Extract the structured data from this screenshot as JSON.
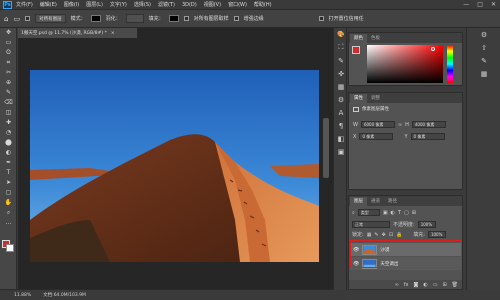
{
  "app": {
    "logo": "Ps"
  },
  "menu": [
    "文件(F)",
    "编辑(E)",
    "图像(I)",
    "图层(L)",
    "文字(Y)",
    "选择(S)",
    "滤镜(T)",
    "3D(D)",
    "视图(V)",
    "窗口(W)",
    "帮助(H)"
  ],
  "window_controls": [
    "—",
    "□",
    "✕"
  ],
  "options": {
    "mode_label": "对所有图层",
    "size_label": "模式：",
    "radius_label": "羽化：",
    "fill_label": "填充：",
    "sample_label": "对所有图层取样",
    "auto_label": "增强边缘",
    "check_label": "打开置位信用任"
  },
  "document": {
    "tab_label": "1撤天空.psd @ 11.7% (沙漠, RGB/8#) *",
    "status_zoom": "11.88%",
    "status_doc": "文档:64.0M/103.9M"
  },
  "tools": [
    "✥",
    "▭",
    "ʘ",
    "⌗",
    "✂",
    "⊕",
    "✎",
    "⌫",
    "◫",
    "✚",
    "◔",
    "⬤",
    "◐",
    "✒",
    "T",
    "➤",
    "▢",
    "✋",
    "⌕",
    "…"
  ],
  "strip_icons": [
    "🎨",
    "⛶",
    "✎",
    "✜",
    "▦",
    "⚙",
    "A",
    "¶",
    "◧",
    "▣"
  ],
  "color_panel": {
    "tabs": [
      "颜色",
      "色板"
    ],
    "fg": "#d62a2a",
    "bg": "#ffffff"
  },
  "properties": {
    "tabs": [
      "属性",
      "调整"
    ],
    "title": "像素图层属性",
    "w_label": "W",
    "w_value": "6000 像素",
    "h_label": "H",
    "h_value": "4000 像素",
    "x_label": "X",
    "x_value": "0 像素",
    "y_label": "Y",
    "y_value": "0 像素"
  },
  "layers_panel": {
    "tabs": [
      "图层",
      "通道",
      "路径"
    ],
    "filter_label": "类型",
    "blend": "正常",
    "opacity_label": "不透明度:",
    "opacity": "100%",
    "lock_label": "锁定:",
    "fill_label": "填充:",
    "fill": "100%",
    "layers": [
      {
        "name": "沙漠",
        "visible": true
      },
      {
        "name": "天空调出",
        "visible": true
      }
    ],
    "highlight_color": "#d92020"
  },
  "far_right_icons": [
    "⚙",
    "⇧",
    "✎",
    "▦"
  ]
}
